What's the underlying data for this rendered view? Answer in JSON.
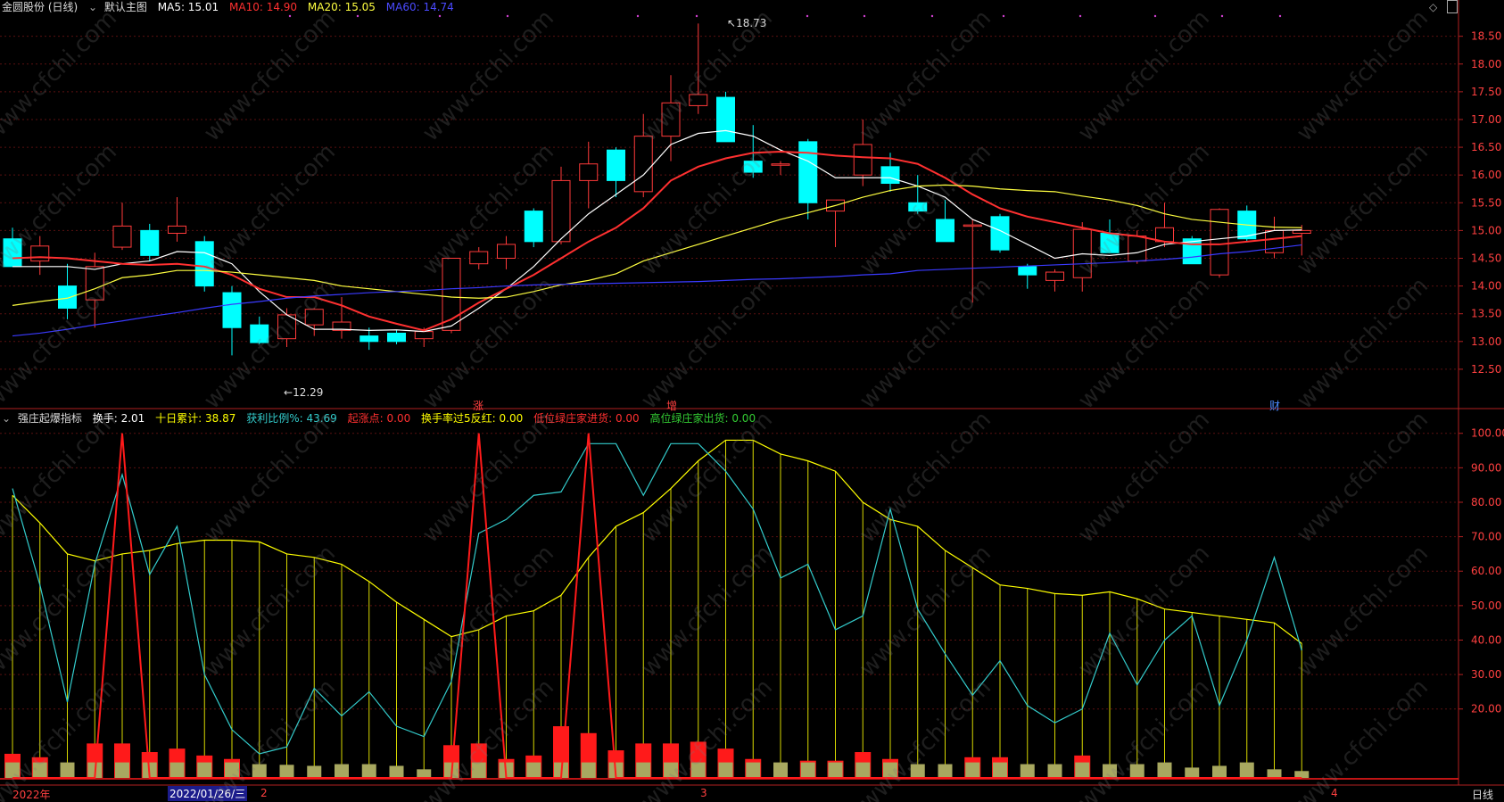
{
  "header_top": {
    "stock_title": "金圆股份 (日线)",
    "main_chart_label": "默认主图",
    "ma5": {
      "label": "MA5: 15.01",
      "color": "#ffffff"
    },
    "ma10": {
      "label": "MA10: 14.90",
      "color": "#ff3030"
    },
    "ma20": {
      "label": "MA20: 15.05",
      "color": "#ffff40"
    },
    "ma60": {
      "label": "MA60: 14.74",
      "color": "#3a3aff"
    }
  },
  "header_bottom": {
    "indicator_name": "强庄起爆指标",
    "items": [
      {
        "label": "换手: 2.01",
        "color": "#ffffff"
      },
      {
        "label": "十日累计: 38.87",
        "color": "#ffff00"
      },
      {
        "label": "获利比例%: 43.69",
        "color": "#33cccc"
      },
      {
        "label": "起涨点: 0.00",
        "color": "#ff3030"
      },
      {
        "label": "换手率过5反红: 0.00",
        "color": "#ffff00"
      },
      {
        "label": "低位绿庄家进货: 0.00",
        "color": "#ff3030"
      },
      {
        "label": "高位绿庄家出货: 0.00",
        "color": "#33cc33"
      }
    ]
  },
  "annotations": {
    "high_label": "18.73",
    "low_label": "12.29",
    "mark_zhang": "涨",
    "mark_zeng": "增",
    "mark_cai": "财"
  },
  "bottom_axis": {
    "year_label": "2022年",
    "date_cursor": "2022/01/26/三",
    "month_2": "2",
    "month_3": "3",
    "month_4": "4",
    "period_label": "日线"
  },
  "watermark_text": "www.cfchi.com",
  "chart_data": [
    {
      "type": "candlestick",
      "title": "金圆股份 (日线)",
      "ylim": [
        12.0,
        18.8
      ],
      "y_ticks": [
        12.5,
        13.0,
        13.5,
        14.0,
        14.5,
        15.0,
        15.5,
        16.0,
        16.5,
        17.0,
        17.5,
        18.0,
        18.5
      ],
      "candles": [
        [
          14.85,
          15.05,
          14.35,
          14.35
        ],
        [
          14.45,
          14.9,
          14.2,
          14.72
        ],
        [
          14.0,
          14.4,
          13.4,
          13.6
        ],
        [
          13.75,
          14.6,
          13.25,
          14.35
        ],
        [
          14.7,
          15.5,
          14.65,
          15.08
        ],
        [
          15.0,
          15.12,
          14.45,
          14.55
        ],
        [
          14.95,
          15.6,
          14.8,
          15.08
        ],
        [
          14.8,
          14.9,
          13.9,
          14.0
        ],
        [
          13.88,
          14.0,
          12.75,
          13.25
        ],
        [
          13.3,
          13.45,
          12.95,
          12.98
        ],
        [
          13.05,
          13.6,
          12.9,
          13.48
        ],
        [
          13.3,
          13.6,
          13.1,
          13.58
        ],
        [
          13.2,
          13.8,
          13.05,
          13.35
        ],
        [
          13.1,
          13.25,
          12.85,
          13.0
        ],
        [
          13.15,
          13.2,
          12.95,
          13.0
        ],
        [
          13.05,
          13.25,
          12.9,
          13.18
        ],
        [
          13.2,
          14.5,
          13.15,
          14.5
        ],
        [
          14.4,
          14.7,
          14.3,
          14.62
        ],
        [
          14.5,
          14.9,
          14.3,
          14.75
        ],
        [
          15.35,
          15.4,
          14.7,
          14.8
        ],
        [
          14.8,
          16.15,
          14.75,
          15.9
        ],
        [
          15.9,
          16.6,
          15.4,
          16.2
        ],
        [
          16.45,
          16.5,
          15.6,
          15.9
        ],
        [
          15.7,
          17.1,
          15.6,
          16.7
        ],
        [
          16.7,
          17.8,
          16.25,
          17.3
        ],
        [
          17.25,
          18.73,
          17.1,
          17.45
        ],
        [
          17.4,
          17.5,
          16.6,
          16.6
        ],
        [
          16.25,
          16.9,
          15.95,
          16.05
        ],
        [
          16.2,
          16.25,
          16.0,
          16.2
        ],
        [
          16.6,
          16.65,
          15.2,
          15.5
        ],
        [
          15.35,
          15.55,
          14.7,
          15.55
        ],
        [
          16.0,
          17.0,
          15.8,
          16.55
        ],
        [
          16.15,
          16.4,
          15.7,
          15.85
        ],
        [
          15.5,
          16.0,
          15.3,
          15.35
        ],
        [
          15.2,
          15.55,
          14.8,
          14.8
        ],
        [
          15.1,
          15.2,
          13.7,
          15.1
        ],
        [
          15.25,
          15.3,
          14.6,
          14.65
        ],
        [
          14.35,
          14.4,
          13.95,
          14.2
        ],
        [
          14.1,
          14.3,
          13.9,
          14.25
        ],
        [
          14.15,
          15.15,
          13.9,
          15.02
        ],
        [
          14.95,
          15.2,
          14.6,
          14.6
        ],
        [
          14.45,
          15.0,
          14.4,
          14.9
        ],
        [
          14.8,
          15.5,
          14.7,
          15.05
        ],
        [
          14.85,
          14.9,
          14.4,
          14.4
        ],
        [
          14.2,
          15.4,
          14.15,
          15.38
        ],
        [
          15.35,
          15.45,
          14.8,
          14.85
        ],
        [
          14.6,
          15.25,
          14.5,
          15.0
        ],
        [
          14.95,
          15.1,
          14.55,
          15.0
        ]
      ],
      "series": [
        {
          "name": "MA5",
          "color": "#ffffff",
          "values": [
            14.35,
            14.35,
            14.35,
            14.3,
            14.4,
            14.45,
            14.62,
            14.6,
            14.4,
            13.9,
            13.48,
            13.22,
            13.22,
            13.2,
            13.21,
            13.18,
            13.28,
            13.6,
            13.95,
            14.35,
            14.85,
            15.3,
            15.65,
            16.0,
            16.55,
            16.75,
            16.8,
            16.7,
            16.45,
            16.25,
            15.95,
            15.95,
            15.95,
            15.8,
            15.6,
            15.2,
            15.0,
            14.75,
            14.5,
            14.58,
            14.55,
            14.6,
            14.75,
            14.8,
            14.85,
            14.9,
            15.0,
            15.01
          ]
        },
        {
          "name": "MA10",
          "color": "#ff3030",
          "values": [
            14.5,
            14.52,
            14.5,
            14.45,
            14.4,
            14.38,
            14.4,
            14.35,
            14.2,
            13.95,
            13.8,
            13.8,
            13.65,
            13.45,
            13.32,
            13.2,
            13.4,
            13.7,
            13.95,
            14.2,
            14.5,
            14.8,
            15.05,
            15.4,
            15.9,
            16.15,
            16.3,
            16.4,
            16.42,
            16.4,
            16.35,
            16.32,
            16.3,
            16.2,
            15.95,
            15.65,
            15.4,
            15.25,
            15.15,
            15.05,
            14.95,
            14.9,
            14.8,
            14.75,
            14.75,
            14.8,
            14.85,
            14.9
          ]
        },
        {
          "name": "MA20",
          "color": "#ffff40",
          "values": [
            13.65,
            13.72,
            13.78,
            13.95,
            14.15,
            14.2,
            14.28,
            14.28,
            14.25,
            14.2,
            14.15,
            14.1,
            14.0,
            13.95,
            13.9,
            13.85,
            13.8,
            13.78,
            13.8,
            13.9,
            14.02,
            14.1,
            14.22,
            14.45,
            14.6,
            14.75,
            14.9,
            15.05,
            15.2,
            15.32,
            15.45,
            15.6,
            15.72,
            15.8,
            15.82,
            15.8,
            15.75,
            15.72,
            15.7,
            15.62,
            15.55,
            15.45,
            15.3,
            15.2,
            15.15,
            15.1,
            15.06,
            15.05
          ]
        },
        {
          "name": "MA60",
          "color": "#3a3aff",
          "values": [
            13.1,
            13.15,
            13.22,
            13.3,
            13.37,
            13.45,
            13.52,
            13.6,
            13.67,
            13.72,
            13.78,
            13.82,
            13.85,
            13.88,
            13.9,
            13.92,
            13.95,
            13.97,
            14.0,
            14.02,
            14.03,
            14.04,
            14.05,
            14.06,
            14.07,
            14.08,
            14.1,
            14.12,
            14.13,
            14.15,
            14.17,
            14.2,
            14.22,
            14.28,
            14.3,
            14.32,
            14.34,
            14.36,
            14.38,
            14.4,
            14.42,
            14.45,
            14.48,
            14.52,
            14.58,
            14.62,
            14.68,
            14.74
          ]
        }
      ]
    },
    {
      "type": "bar+line",
      "title": "强庄起爆指标",
      "ylim": [
        0,
        102
      ],
      "y_ticks": [
        20,
        30,
        40,
        50,
        60,
        70,
        80,
        90,
        100
      ],
      "turnover_bars": [
        4.5,
        4.5,
        4.5,
        4.5,
        4.5,
        4.5,
        4.5,
        4.5,
        4.5,
        4.0,
        3.8,
        3.5,
        4.0,
        4.0,
        3.5,
        2.5,
        4.5,
        4.5,
        4.5,
        4.5,
        4.5,
        4.5,
        4.5,
        4.5,
        4.5,
        4.5,
        4.5,
        4.5,
        4.5,
        4.5,
        4.5,
        4.5,
        4.5,
        4.0,
        4.0,
        4.5,
        4.5,
        4.0,
        4.0,
        4.5,
        4.0,
        4.0,
        4.5,
        3.0,
        3.5,
        4.5,
        2.5,
        2.0
      ],
      "red_bars": [
        7.0,
        6.0,
        0,
        10.0,
        10.0,
        7.5,
        8.5,
        6.5,
        5.5,
        0,
        0,
        0,
        0,
        0,
        0,
        0,
        9.5,
        10.0,
        5.5,
        6.5,
        15.0,
        13.0,
        8.0,
        10.0,
        10.0,
        10.5,
        8.5,
        5.5,
        0,
        5.0,
        5.0,
        7.5,
        5.5,
        0,
        0,
        6.0,
        6.0,
        0,
        0,
        6.5,
        0,
        0,
        0,
        0,
        0,
        0,
        0,
        0
      ],
      "series": [
        {
          "name": "十日累计",
          "color": "#ffff00",
          "values": [
            82,
            74,
            65,
            63,
            65,
            66,
            68,
            69,
            69,
            68.5,
            65,
            64,
            62,
            57,
            51,
            46,
            41,
            43,
            47,
            48.5,
            53,
            64,
            73,
            77,
            84,
            92,
            98,
            98,
            94,
            92,
            89,
            80,
            75,
            73,
            66,
            61,
            56,
            55,
            53.5,
            53,
            54,
            52,
            49,
            48,
            47,
            46,
            45,
            39
          ]
        },
        {
          "name": "获利比例%",
          "color": "#33cccc",
          "values": [
            84,
            56,
            22,
            62,
            88,
            59,
            73,
            30,
            14,
            7,
            9,
            26,
            18,
            25,
            15,
            12,
            28,
            71,
            75,
            82,
            83,
            97,
            97,
            82,
            97,
            97,
            89,
            78,
            58,
            62,
            43,
            47,
            78,
            49,
            36,
            24,
            34,
            21,
            16,
            20,
            42,
            27,
            40,
            47,
            21,
            40,
            64,
            37,
            48,
            44
          ]
        },
        {
          "name": "起涨点",
          "color": "#ff1a1a",
          "values": [
            0,
            0,
            0,
            0,
            100,
            0,
            0,
            0,
            0,
            0,
            0,
            0,
            0,
            0,
            0,
            0,
            0,
            100,
            0,
            0,
            0,
            100,
            0,
            0,
            0,
            0,
            0,
            0,
            0,
            0,
            0,
            0,
            0,
            0,
            0,
            0,
            0,
            0,
            0,
            0,
            0,
            0,
            0,
            0,
            0,
            0,
            0,
            0
          ]
        }
      ]
    }
  ]
}
